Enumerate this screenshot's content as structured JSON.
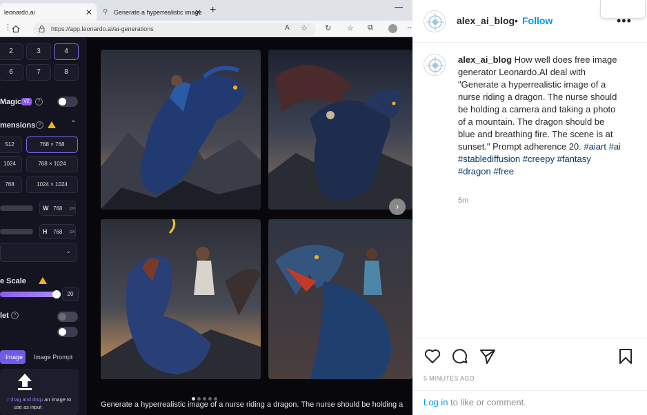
{
  "browser": {
    "tabs": [
      {
        "label": "leonardo.ai",
        "close": "✕"
      },
      {
        "label": "Generate a hyperrealistic image",
        "close": "✕"
      }
    ],
    "new_tab": "+",
    "url": "https://app.leonardo.ai/ai-generations"
  },
  "sidebar": {
    "num_buttons": [
      "2",
      "3",
      "4",
      "6",
      "7",
      "8"
    ],
    "magic_label": "Magic",
    "magic_badge": "V2",
    "dimensions_label": "mensions",
    "dimension_options": [
      "512",
      "768 × 768",
      "1024",
      "768 × 1024",
      "768",
      "1024 × 1024"
    ],
    "width_label": "W",
    "width_value": "768",
    "height_label": "H",
    "height_value": "768",
    "unit": "px",
    "guidance_label": "e Scale",
    "guidance_value": "20",
    "tiling_label": "let",
    "image_tab_label": "Image",
    "image_prompt_tab": "Image Prompt",
    "upload_text_highlight": "r drag and drop",
    "upload_text_rest": " an image to",
    "upload_text_line2": "use as input"
  },
  "gallery": {
    "caption": "Generate a hyperrealistic image of a nurse riding a dragon. The nurse should be holding a",
    "next_label": "›"
  },
  "instagram": {
    "username": "alex_ai_blog",
    "separator": "•",
    "follow_label": "Follow",
    "more_label": "•••",
    "caption_text": "How well does free image generator Leonardo.AI deal with \"Generate a hyperrealistic image of a nurse riding a dragon. The nurse should be holding a camera and taking a photo of a mountain. The dragon should be blue and breathing fire. The scene is at sunset.\" Prompt adherence 20.",
    "hashtags": [
      "#aiart",
      "#ai",
      "#stablediffusion",
      "#creepy",
      "#fantasy",
      "#dragon",
      "#free"
    ],
    "time_short": "5m",
    "time_long": "5 MINUTES AGO",
    "login_link": "Log in",
    "login_rest": " to like or comment."
  },
  "colors": {
    "accent_purple": "#7c6cf0",
    "warning": "#f3b21c",
    "ig_blue": "#0095f6",
    "hashtag": "#00376b"
  }
}
